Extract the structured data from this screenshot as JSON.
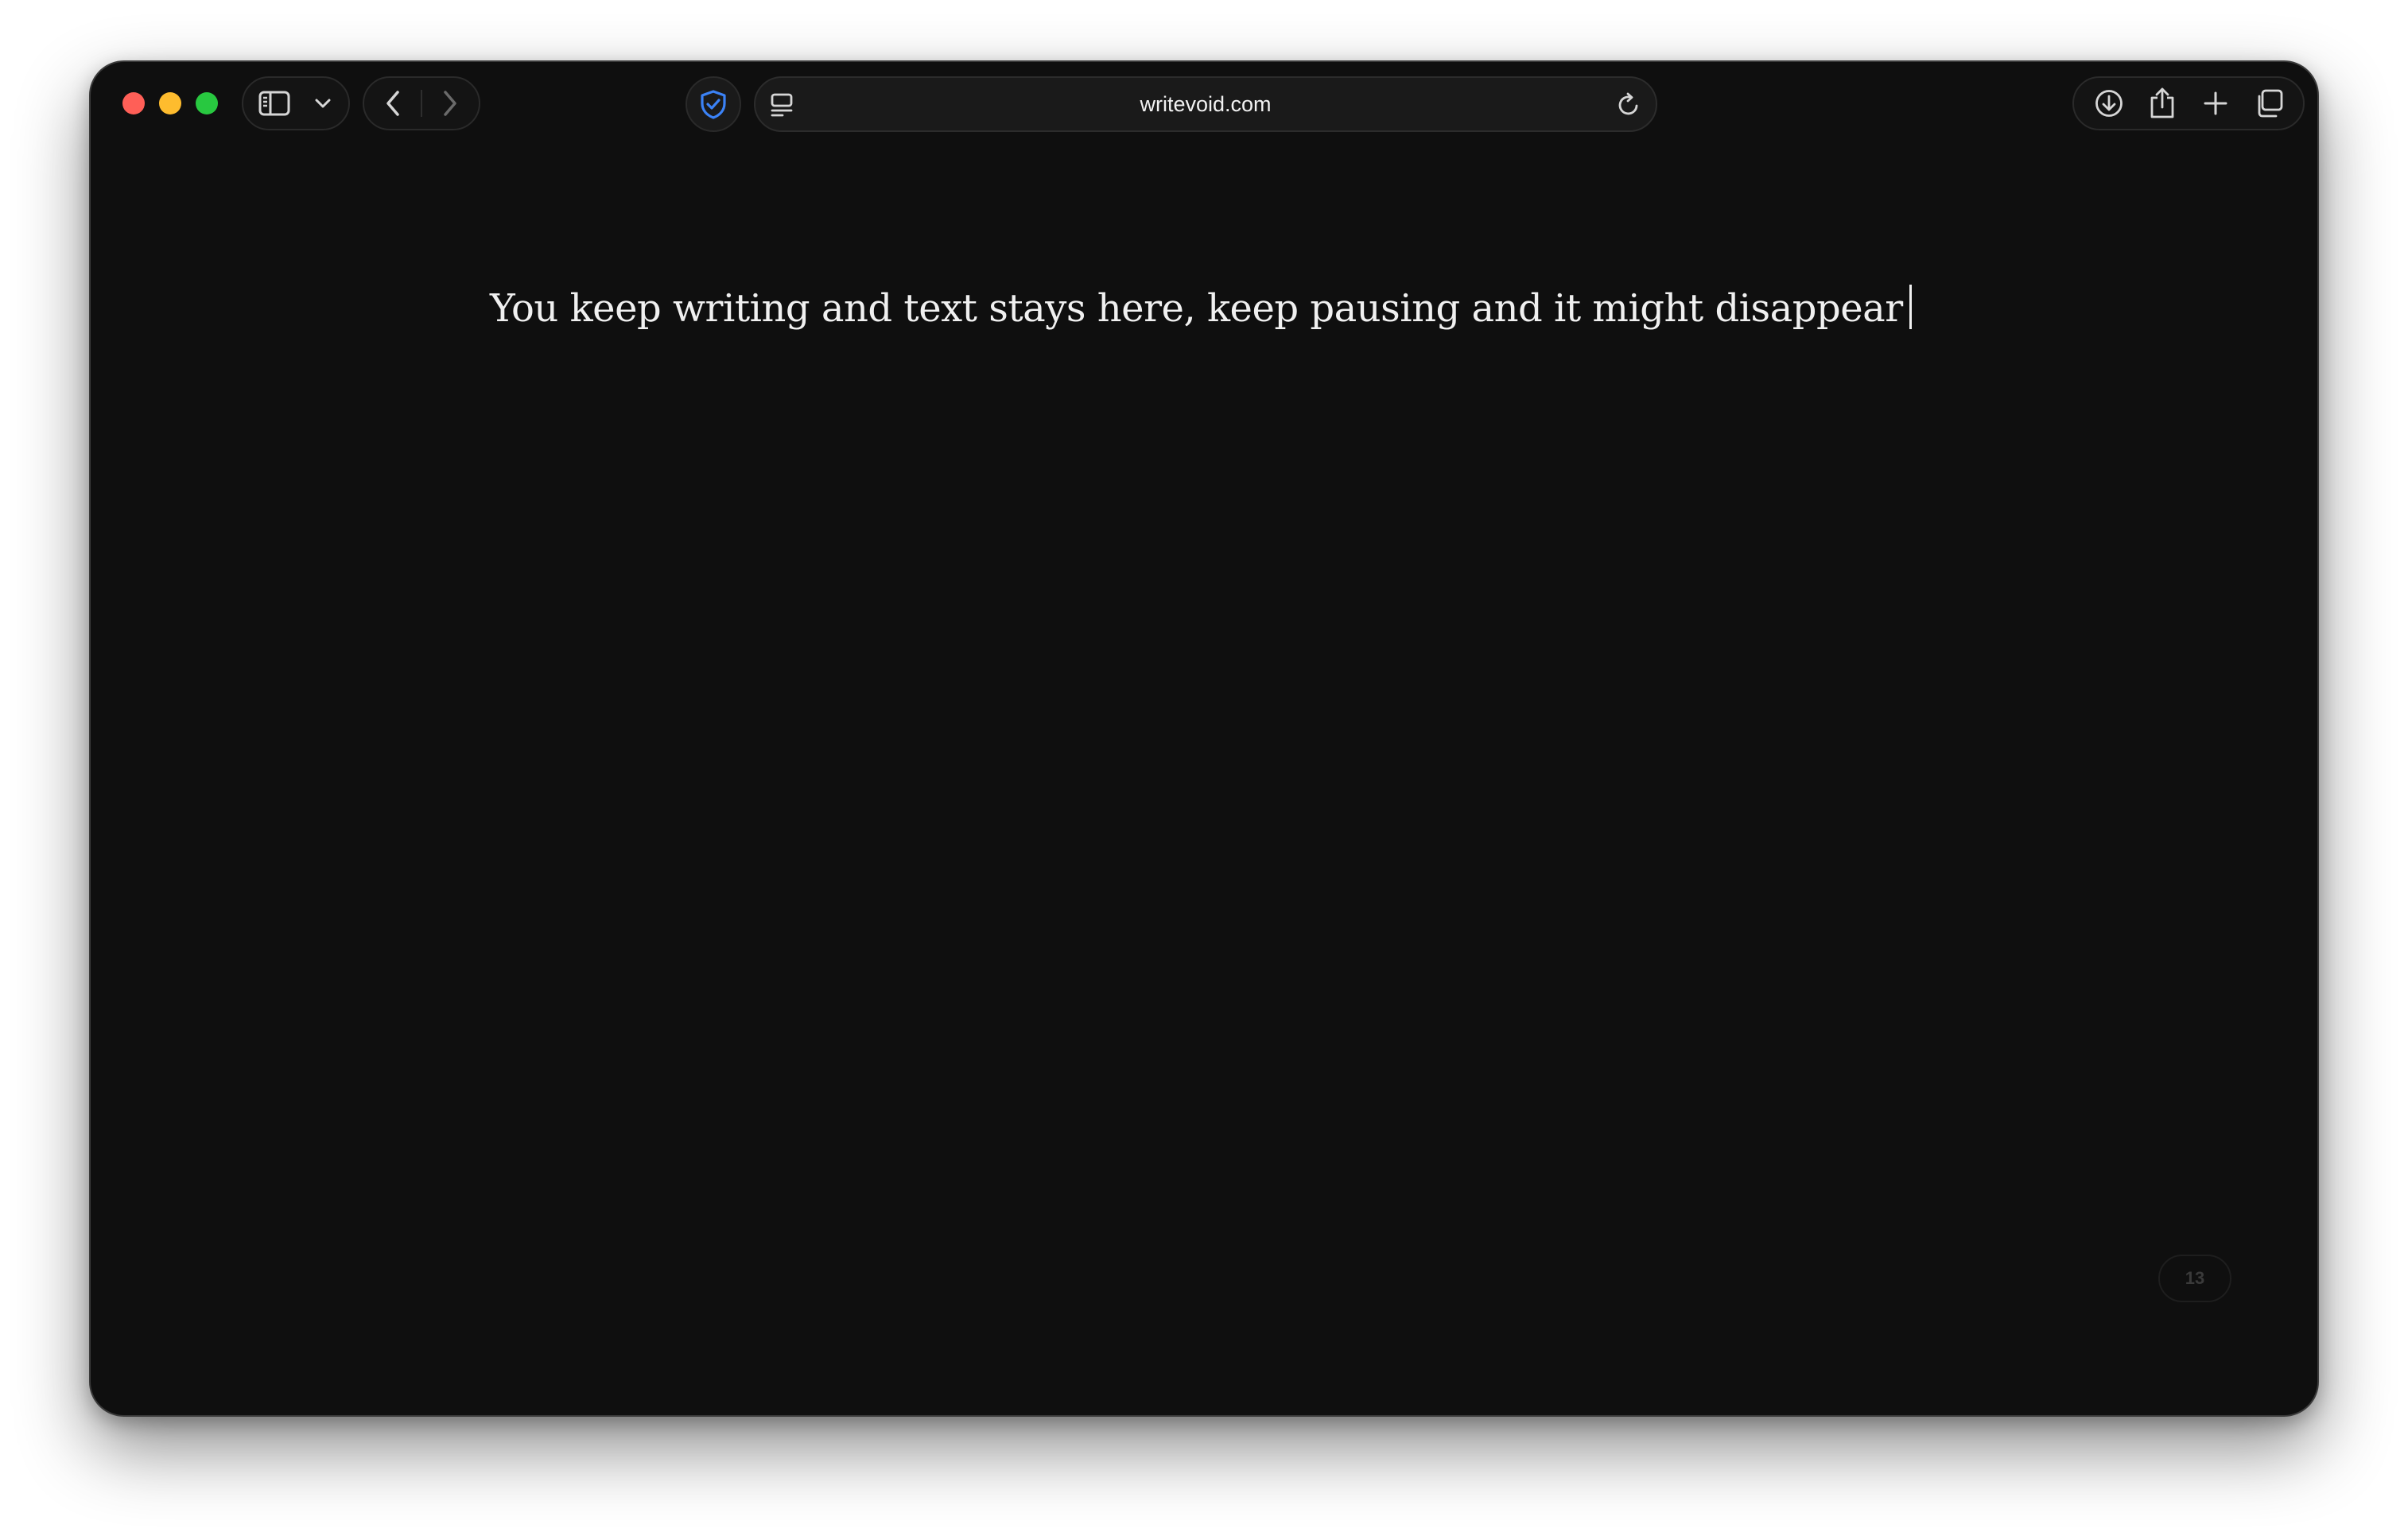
{
  "browser": {
    "address_bar": {
      "url": "writevoid.com"
    },
    "icons": {
      "sidebar": "sidebar-icon",
      "tab_group_menu": "chevron-down-icon",
      "back": "chevron-left-icon",
      "forward": "chevron-right-icon",
      "privacy": "shield-icon",
      "reader": "reader-mode-icon",
      "reload": "reload-icon",
      "downloads": "download-icon",
      "share": "share-icon",
      "new_tab": "plus-icon",
      "tab_overview": "tabs-overview-icon"
    },
    "colors": {
      "close": "#ff5f57",
      "minimize": "#febc2e",
      "maximize": "#28c840",
      "privacy_accent": "#3b82f6"
    }
  },
  "editor": {
    "text": "You keep writing and text stays here, keep pausing and it might disappear",
    "counter": "13",
    "background": "#0f0f0f",
    "text_color": "#f0f0f0"
  }
}
